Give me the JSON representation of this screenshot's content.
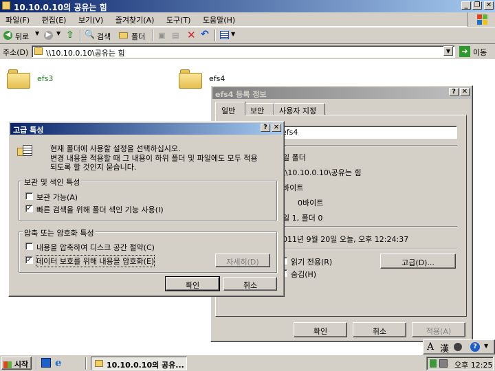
{
  "window": {
    "title": "10.10.0.10의 공유는 힘"
  },
  "menu": [
    "파일(F)",
    "편집(E)",
    "보기(V)",
    "즐겨찾기(A)",
    "도구(T)",
    "도움말(H)"
  ],
  "toolbar": {
    "back": "뒤로",
    "search": "검색",
    "folders": "폴더"
  },
  "address": {
    "label": "주소(D)",
    "value": "\\\\10.10.0.10\\공유는 힘",
    "go": "이동"
  },
  "folders": [
    "efs3",
    "efs4"
  ],
  "props": {
    "title": "efs4 등록 정보",
    "tabs": [
      "일반",
      "보안",
      "사용자 지정"
    ],
    "name": "efs4",
    "type": "일 폴더",
    "location": "\\\\10.10.0.10\\공유는 힘",
    "size": "바이트",
    "size_on_disk": "0바이트",
    "contains": "일 1, 폴더 0",
    "created": "011년 9월 20일 오늘, 오후 12:24:37",
    "readonly": "읽기 전용(R)",
    "hidden": "숨김(H)",
    "advanced": "고급(D)...",
    "ok": "확인",
    "cancel": "취소",
    "apply": "적용(A)"
  },
  "adv": {
    "title": "고급 특성",
    "desc1": "현재 폴더에 사용할 설정을 선택하십시오.",
    "desc2": "변경 내용을 적용할 때 그 내용이 하위 폴더 및 파일에도 모두 적용",
    "desc3": "되도록 할 것인지 묻습니다.",
    "group1": "보관 및 색인 특성",
    "archive": "보관 가능(A)",
    "index": "빠른 검색을 위해 폴더 색인 기능 사용(I)",
    "group2": "압축 또는 암호화 특성",
    "compress": "내용을 압축하여 디스크 공간 절약(C)",
    "encrypt": "데이터 보호를 위해 내용을 암호화(E)",
    "details": "자세히(D)",
    "ok": "확인",
    "cancel": "취소"
  },
  "taskbar": {
    "start": "시작",
    "task": "10.10.0.10의 공유...",
    "time": "오후 12:25"
  },
  "lang_bar": {
    "a": "A",
    "han": "漢"
  }
}
